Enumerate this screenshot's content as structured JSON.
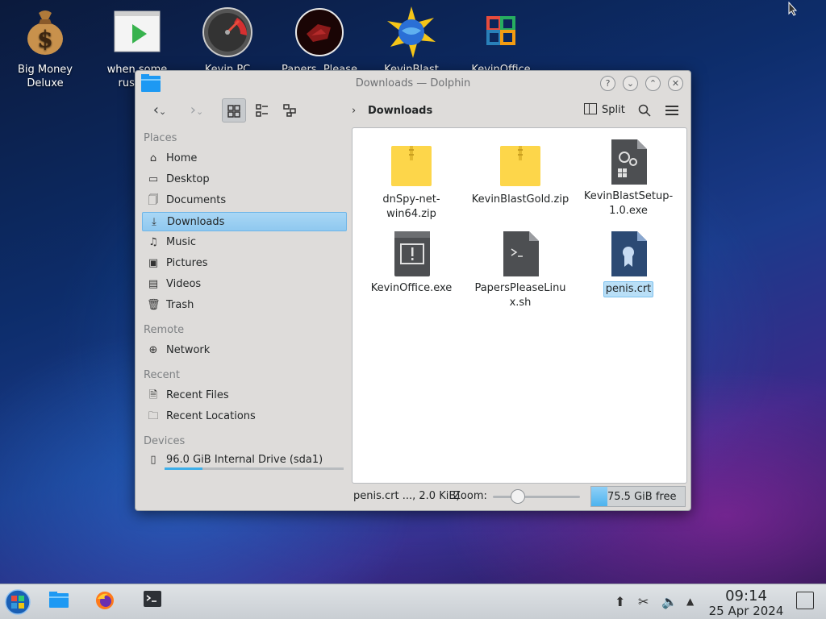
{
  "desktop": {
    "icons": [
      {
        "label": "Big Money Deluxe",
        "icon": "money-bag-icon"
      },
      {
        "label": "when some russian",
        "icon": "video-play-icon"
      },
      {
        "label": "Kevin PC",
        "icon": "speedometer-icon"
      },
      {
        "label": "Papers, Please",
        "icon": "papers-please-icon"
      },
      {
        "label": "KevinBlast",
        "icon": "globe-star-icon"
      },
      {
        "label": "KevinOffice",
        "icon": "office-logo-icon"
      }
    ]
  },
  "window": {
    "title": "Downloads — Dolphin",
    "buttons": [
      "help",
      "minimize",
      "maximize",
      "close"
    ],
    "toolbar": {
      "breadcrumb": "Downloads",
      "split_label": "Split"
    },
    "sidebar": {
      "sections": {
        "places": "Places",
        "remote": "Remote",
        "recent": "Recent",
        "devices": "Devices"
      },
      "places": [
        {
          "label": "Home",
          "icon": "home-icon"
        },
        {
          "label": "Desktop",
          "icon": "desktop-icon"
        },
        {
          "label": "Documents",
          "icon": "documents-icon"
        },
        {
          "label": "Downloads",
          "icon": "download-icon",
          "selected": true
        },
        {
          "label": "Music",
          "icon": "music-icon"
        },
        {
          "label": "Pictures",
          "icon": "pictures-icon"
        },
        {
          "label": "Videos",
          "icon": "videos-icon"
        },
        {
          "label": "Trash",
          "icon": "trash-icon"
        }
      ],
      "remote": [
        {
          "label": "Network",
          "icon": "network-icon"
        }
      ],
      "recent": [
        {
          "label": "Recent Files",
          "icon": "recent-files-icon"
        },
        {
          "label": "Recent Locations",
          "icon": "recent-locations-icon"
        }
      ],
      "devices": [
        {
          "label": "96.0 GiB Internal Drive (sda1)",
          "icon": "drive-icon",
          "used_fraction": 0.21
        }
      ]
    },
    "files": [
      {
        "name": "dnSpy-net-win64.zip",
        "icon": "zip-icon"
      },
      {
        "name": "KevinBlastGold.zip",
        "icon": "zip-icon"
      },
      {
        "name": "KevinBlastSetup-1.0.exe",
        "icon": "exe-gear-icon"
      },
      {
        "name": "KevinOffice.exe",
        "icon": "exe-alert-icon"
      },
      {
        "name": "PapersPleaseLinux.sh",
        "icon": "shell-script-icon"
      },
      {
        "name": "penis.crt",
        "icon": "certificate-icon",
        "selected": true
      }
    ],
    "statusbar": {
      "selection": "penis.crt ..., 2.0 KiB)",
      "zoom_label": "Zoom:",
      "free_space": "75.5 GiB free"
    }
  },
  "taskbar": {
    "clock_time": "09:14",
    "clock_date": "25 Apr 2024"
  },
  "colors": {
    "accent": "#3daee9",
    "selection": "#a9d7f5",
    "zip_yellow": "#fdd64a"
  }
}
